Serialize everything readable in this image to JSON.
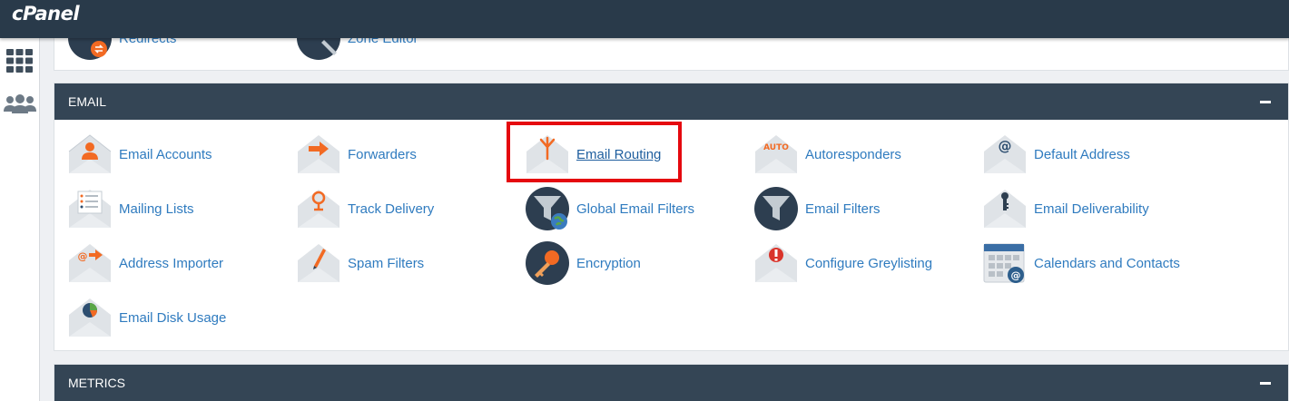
{
  "header": {
    "logo": "cPanel"
  },
  "sidebar": {
    "items": [
      {
        "icon": "grid-icon"
      },
      {
        "icon": "users-icon"
      }
    ]
  },
  "top_partial": {
    "items": [
      {
        "label": "Redirects",
        "icon": "redirects-icon"
      },
      {
        "label": "Zone Editor",
        "icon": "zone-editor-icon"
      }
    ]
  },
  "email": {
    "title": "EMAIL",
    "items": [
      {
        "label": "Email Accounts",
        "icon": "email-accounts-icon"
      },
      {
        "label": "Forwarders",
        "icon": "forwarders-icon"
      },
      {
        "label": "Email Routing",
        "icon": "email-routing-icon"
      },
      {
        "label": "Autoresponders",
        "icon": "autoresponders-icon"
      },
      {
        "label": "Default Address",
        "icon": "default-address-icon"
      },
      {
        "label": "Mailing Lists",
        "icon": "mailing-lists-icon"
      },
      {
        "label": "Track Delivery",
        "icon": "track-delivery-icon"
      },
      {
        "label": "Global Email Filters",
        "icon": "global-email-filters-icon"
      },
      {
        "label": "Email Filters",
        "icon": "email-filters-icon"
      },
      {
        "label": "Email Deliverability",
        "icon": "email-deliverability-icon"
      },
      {
        "label": "Address Importer",
        "icon": "address-importer-icon"
      },
      {
        "label": "Spam Filters",
        "icon": "spam-filters-icon"
      },
      {
        "label": "Encryption",
        "icon": "encryption-icon"
      },
      {
        "label": "Configure Greylisting",
        "icon": "greylisting-icon"
      },
      {
        "label": "Calendars and Contacts",
        "icon": "calendars-contacts-icon"
      },
      {
        "label": "Email Disk Usage",
        "icon": "email-disk-usage-icon"
      }
    ],
    "autoresponder_badge": "AUTO"
  },
  "metrics": {
    "title": "METRICS"
  },
  "colors": {
    "header": "#293a4a",
    "panel_header": "#344555",
    "link": "#2f7bbf",
    "accent": "#f26a23",
    "highlight": "#e5090f"
  }
}
